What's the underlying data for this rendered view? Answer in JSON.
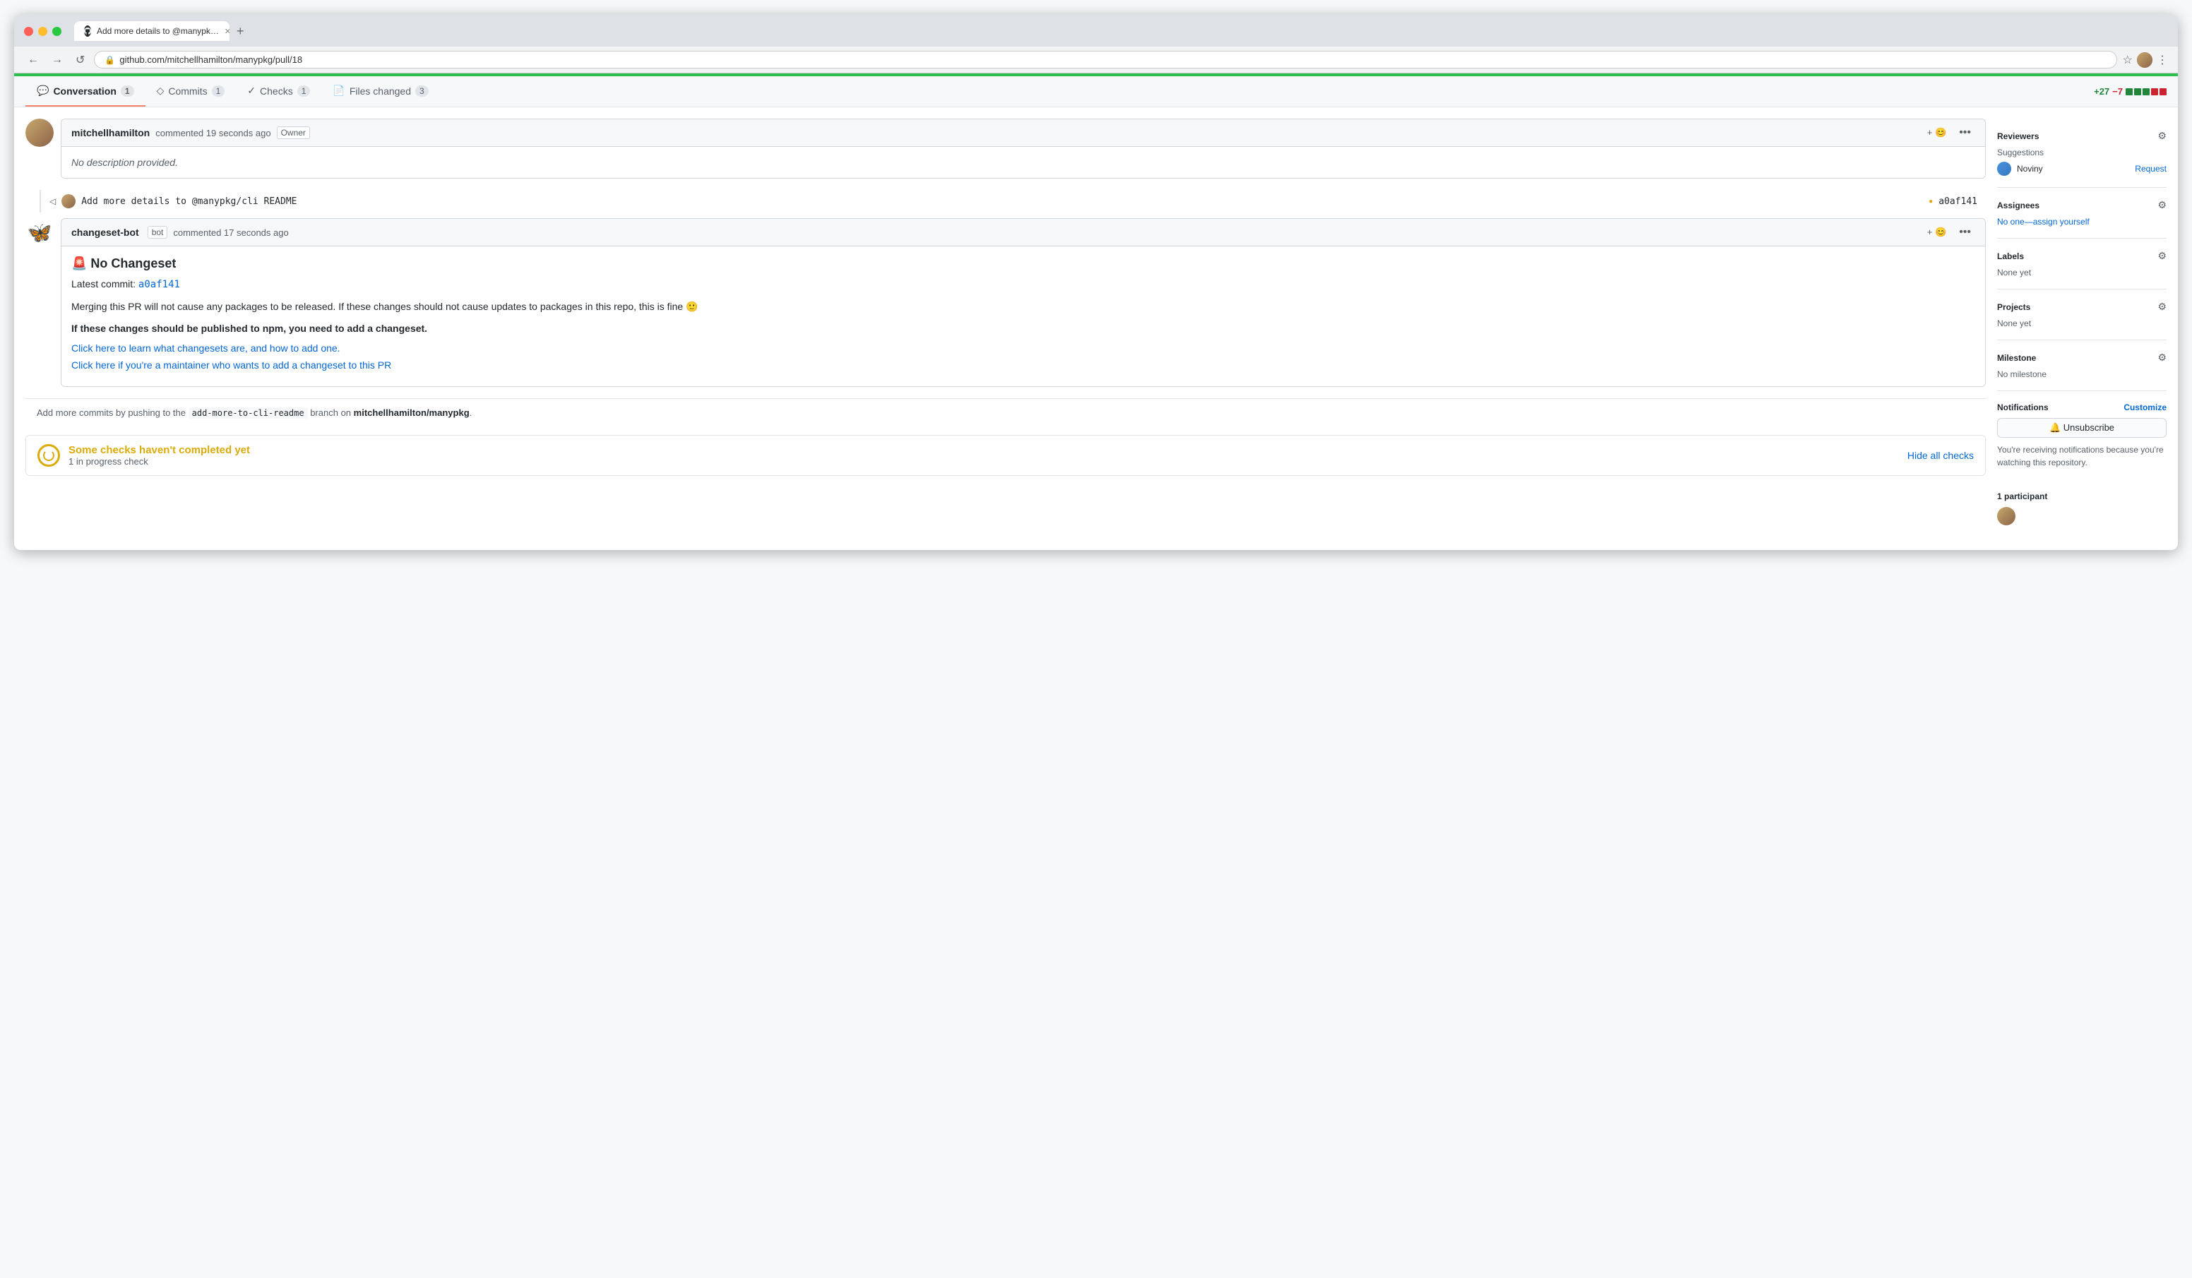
{
  "browser": {
    "tab_title": "Add more details to @manypk…",
    "url": "github.com/mitchellhamilton/manypkg/pull/18",
    "favicon": "⚫"
  },
  "pr": {
    "tabs": [
      {
        "id": "conversation",
        "label": "Conversation",
        "icon": "💬",
        "count": "1",
        "active": true
      },
      {
        "id": "commits",
        "label": "Commits",
        "icon": "◇",
        "count": "1",
        "active": false
      },
      {
        "id": "checks",
        "label": "Checks",
        "icon": "✓",
        "count": "1",
        "active": false
      },
      {
        "id": "files-changed",
        "label": "Files changed",
        "icon": "📄",
        "count": "3",
        "active": false
      }
    ],
    "diff_stats": {
      "additions": "+27",
      "deletions": "−7"
    }
  },
  "comments": [
    {
      "id": "comment-1",
      "author": "mitchellhamilton",
      "time_text": "commented 19 seconds ago",
      "badge": "Owner",
      "body": "No description provided.",
      "body_is_empty": true
    },
    {
      "id": "comment-2",
      "author": "changeset-bot",
      "author_badge": "bot",
      "time_text": "commented 17 seconds ago",
      "title": "🚨 No Changeset",
      "latest_commit_label": "Latest commit:",
      "latest_commit_sha": "a0af141",
      "desc": "Merging this PR will not cause any packages to be released. If these changes should not cause updates to packages in this repo, this is fine 🙂",
      "important": "If these changes should be published to npm, you need to add a changeset.",
      "link1": "Click here to learn what changesets are, and how to add one.",
      "link2": "Click here if you're a maintainer who wants to add a changeset to this PR"
    }
  ],
  "commit_ref": {
    "message": "Add more details to @manypkg/cli README",
    "sha": "a0af141"
  },
  "push_info": {
    "prefix": "Add more commits by pushing to the",
    "branch": "add-more-to-cli-readme",
    "suffix": "branch on",
    "repo": "mitchellhamilton/manypkg",
    "period": "."
  },
  "checks_section": {
    "title": "Some checks haven't completed yet",
    "subtitle": "1 in progress check",
    "hide_btn": "Hide all checks"
  },
  "sidebar": {
    "reviewers": {
      "title": "Reviewers",
      "suggestions_label": "Suggestions",
      "reviewer_name": "Noviny",
      "request_label": "Request"
    },
    "assignees": {
      "title": "Assignees",
      "value": "No one—assign yourself"
    },
    "labels": {
      "title": "Labels",
      "value": "None yet"
    },
    "projects": {
      "title": "Projects",
      "value": "None yet"
    },
    "milestone": {
      "title": "Milestone",
      "value": "No milestone"
    },
    "notifications": {
      "title": "Notifications",
      "customize_label": "Customize",
      "unsubscribe_label": "🔔 Unsubscribe",
      "desc": "You're receiving notifications because you're watching this repository."
    },
    "participants": {
      "title": "1 participant"
    }
  }
}
